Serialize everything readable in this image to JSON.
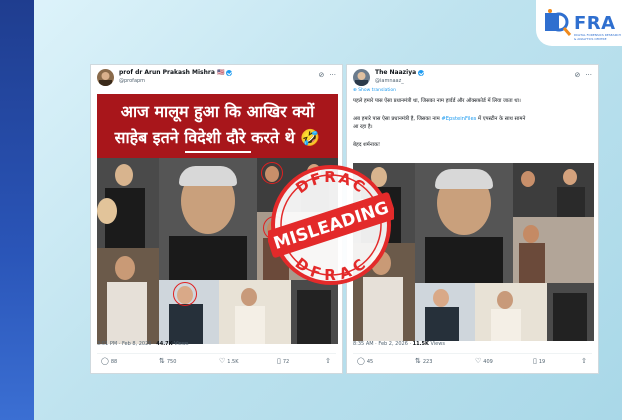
{
  "brand": {
    "logo_text": "FRA",
    "logo_tagline": "DIGITAL FORENSICS RESEARCH & ANALYTICS CENTRE"
  },
  "stamp": {
    "top_text": "DFRAC",
    "bottom_text": "DFRAC",
    "label": "MISLEADING",
    "color": "#e32a2a"
  },
  "left_tweet": {
    "user_name": "prof dr Arun Prakash Mishra 🇺🇸",
    "handle": "@profapm",
    "image_text_line1": "आज मालूम हुआ कि आखिर क्यों",
    "image_text_line2": "साहेब इतने विदेशी दौरे करते थे 🤣",
    "time": "3:01 PM",
    "date": "Feb 8, 2026",
    "views_count": "44.7K",
    "views_label": "Views",
    "replies": "88",
    "reposts": "750",
    "likes": "1.5K",
    "bookmarks": "72"
  },
  "right_tweet": {
    "user_name": "The Naaziya",
    "handle": "@iamnaaz_",
    "show_translation": "Show translation",
    "text_line1": "पहले हमारे पास ऐसा प्रधानमंत्री था, जिसका नाम हार्वर्ड और ऑक्सफ़ोर्ड में लिया जाता था।",
    "text_line2_prefix": "अब हमारे पास ऐसा प्रधानमंत्री है, जिसका नाम ",
    "text_line2_link": "#EpsteinFiles",
    "text_line2_suffix": " में एपस्टीन के साथ सामने",
    "text_line3": "आ रहा है।",
    "text_line4": "बेहद शर्मनाक!",
    "time": "8:35 AM",
    "date": "Feb 2, 2026",
    "views_count": "11.5K",
    "views_label": "Views",
    "replies": "45",
    "reposts": "223",
    "likes": "409",
    "bookmarks": "19"
  }
}
